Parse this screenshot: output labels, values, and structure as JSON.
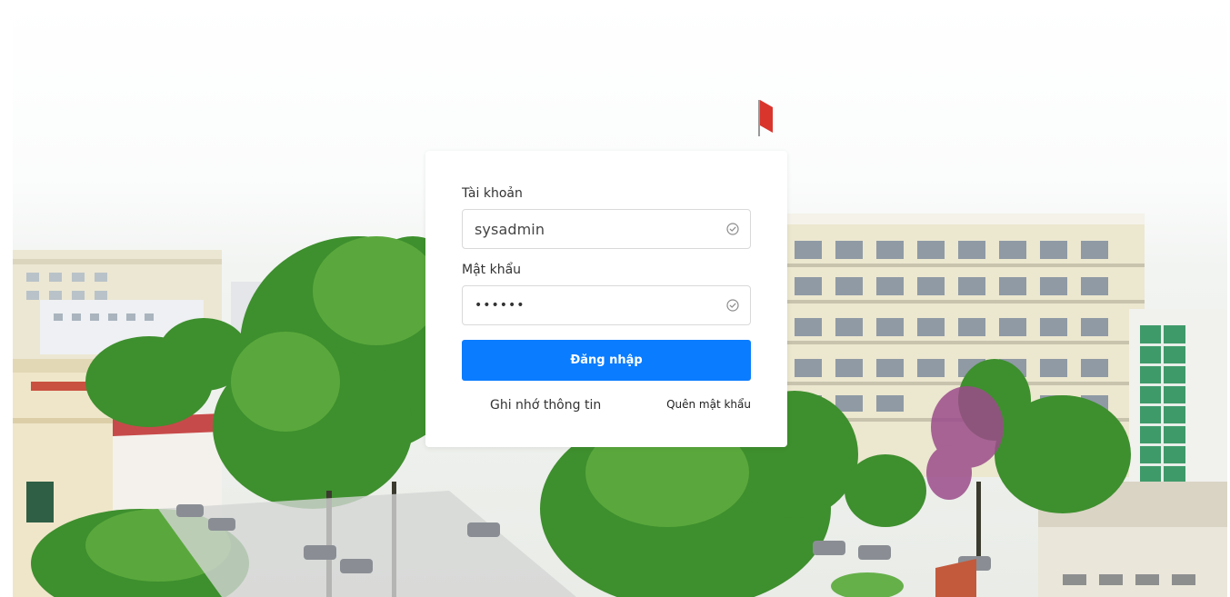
{
  "login": {
    "username_label": "Tài khoản",
    "username_value": "sysadmin",
    "password_label": "Mật khẩu",
    "password_value": "••••••",
    "submit_label": "Đăng nhập",
    "remember_label": "Ghi nhớ thông tin",
    "forgot_label": "Quên mật khẩu"
  },
  "colors": {
    "primary": "#0a7cff",
    "card_background": "#ffffff",
    "input_border": "#d9d9d9"
  },
  "icons": {
    "username_status": "check-circle-icon",
    "password_status": "check-circle-icon"
  }
}
